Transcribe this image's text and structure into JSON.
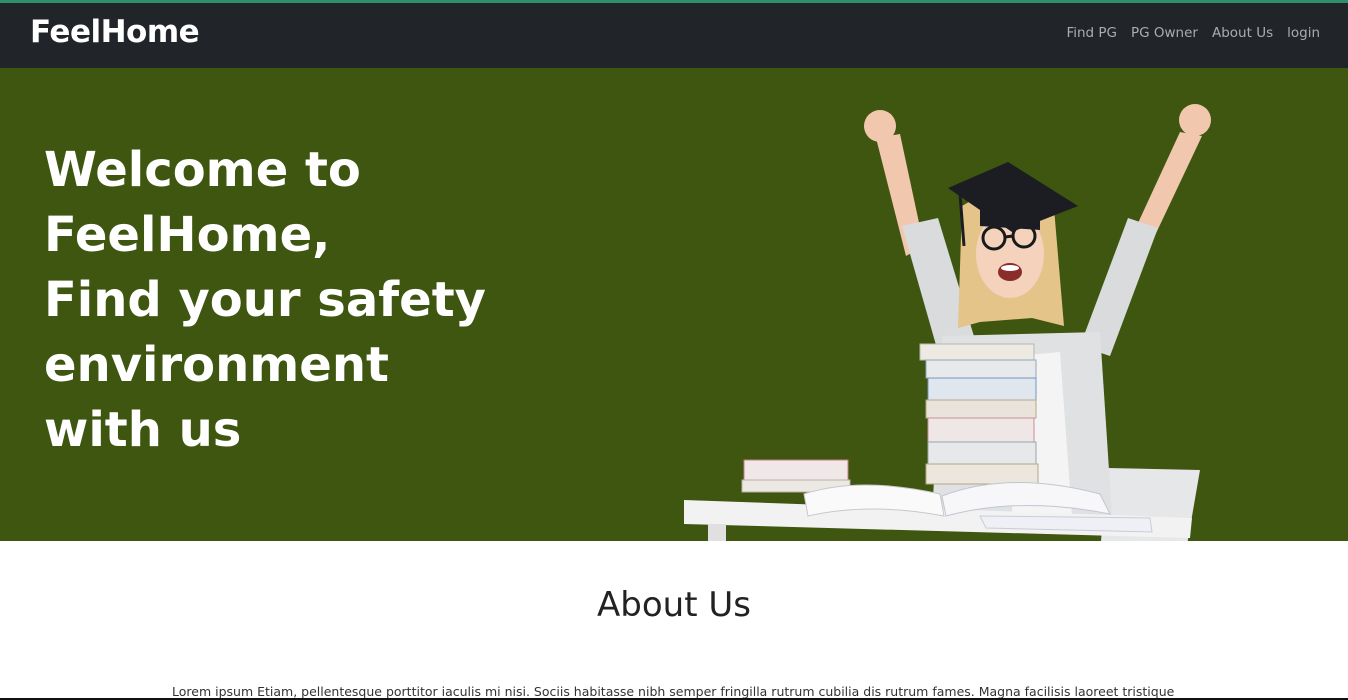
{
  "brand": "FeelHome",
  "nav": {
    "items": [
      "Find PG",
      "PG Owner",
      "About Us",
      "login"
    ]
  },
  "hero": {
    "lines": [
      "Welcome to",
      "FeelHome,",
      "Find your safety",
      "environment",
      "with us"
    ],
    "illustration": "graduate-student-celebrating-icon"
  },
  "about": {
    "title": "About Us",
    "text": "Lorem ipsum Etiam, pellentesque porttitor iaculis mi nisi. Sociis habitasse nibh semper fringilla rutrum cubilia dis rutrum fames. Magna facilisis laoreet tristique"
  },
  "colors": {
    "navbar": "#212429",
    "hero_bg": "#3e560f",
    "accent_line": "#2f8f6a"
  }
}
